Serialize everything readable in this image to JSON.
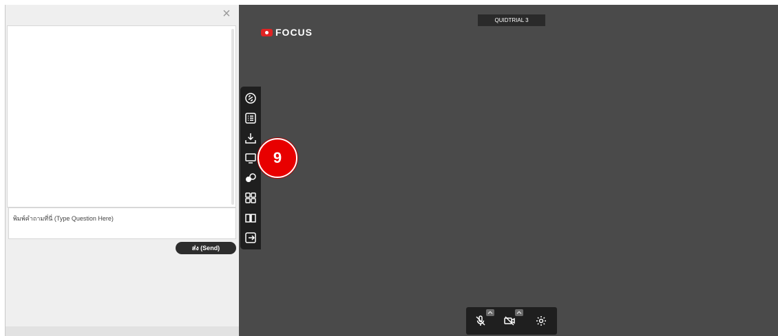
{
  "chat": {
    "input_placeholder": "พิมพ์คำถามที่นี่ (Type Question Here)",
    "send_label": "ส่ง (Send)"
  },
  "brand": {
    "logo_text": "FOCUS"
  },
  "room": {
    "name": "QUIDTRIAL 3"
  },
  "toolbar": {
    "items": [
      "link-icon",
      "list-icon",
      "download-icon",
      "whiteboard-icon",
      "share-icon",
      "grid-icon",
      "book-icon",
      "exit-icon"
    ]
  },
  "step_marker": {
    "number": "9"
  },
  "controls": {
    "items": [
      "mic-muted-icon",
      "camera-off-icon",
      "settings-icon"
    ]
  }
}
